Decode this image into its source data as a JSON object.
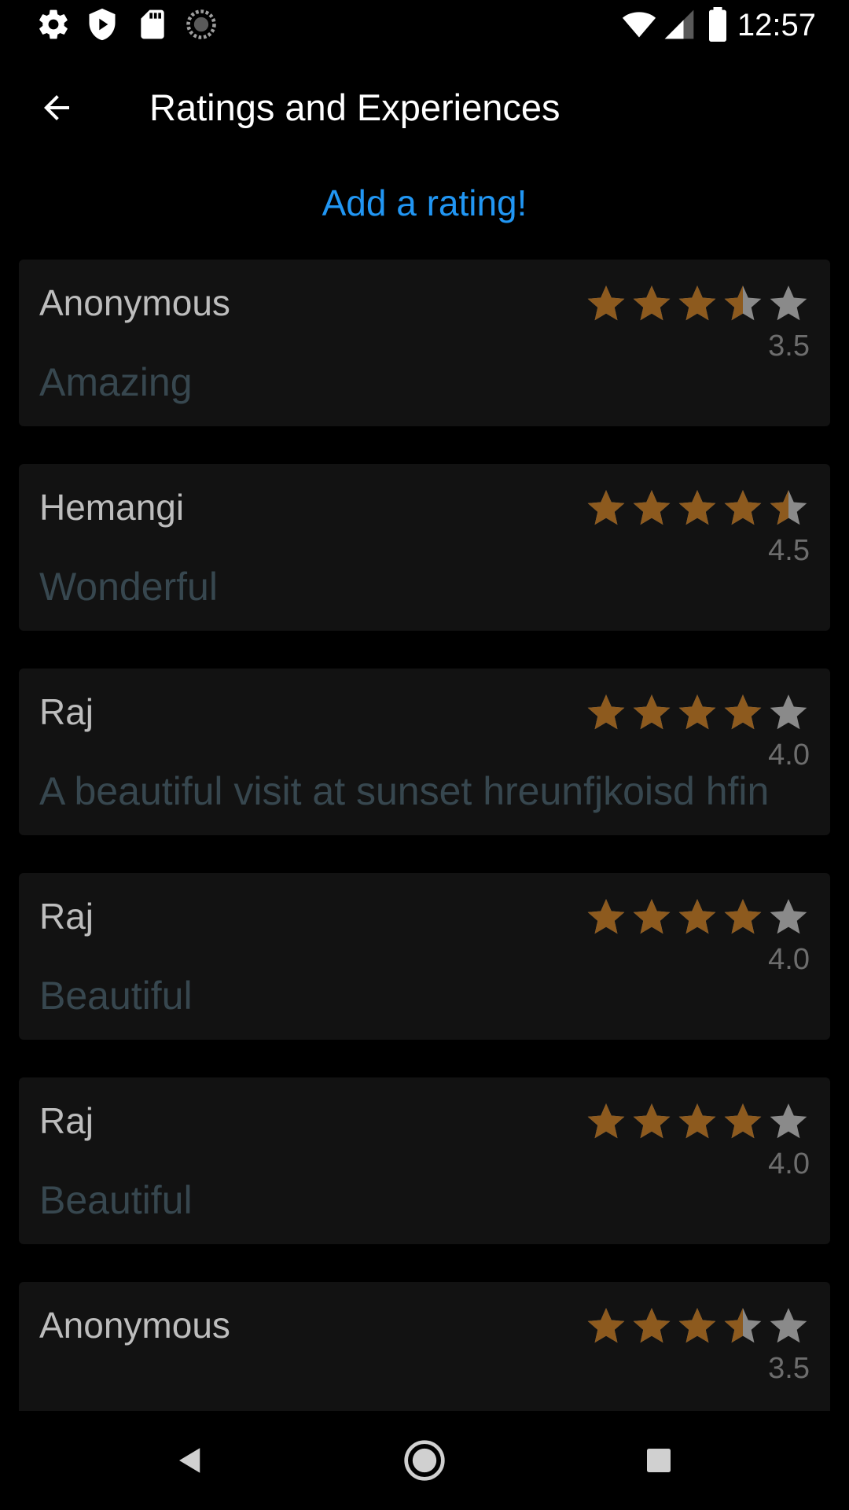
{
  "status_bar": {
    "time": "12:57",
    "left_icons": [
      "settings-icon",
      "shield-icon",
      "sd-card-icon",
      "sync-icon"
    ],
    "right_icons": [
      "wifi-icon",
      "signal-icon",
      "battery-icon"
    ]
  },
  "app_bar": {
    "title": "Ratings and Experiences",
    "back_icon": "arrow-back-icon"
  },
  "add_rating_label": "Add a rating!",
  "colors": {
    "background": "#000000",
    "card": "#121212",
    "accent": "#2196f3",
    "star_filled": "#8d5a1e",
    "star_empty": "#8a8a8a",
    "name_text": "#bdbdbd",
    "review_text": "#37474f"
  },
  "reviews": [
    {
      "name": "Anonymous",
      "rating": 3.5,
      "rating_label": "3.5",
      "text": "Amazing"
    },
    {
      "name": "Hemangi",
      "rating": 4.5,
      "rating_label": "4.5",
      "text": "Wonderful"
    },
    {
      "name": "Raj",
      "rating": 4.0,
      "rating_label": "4.0",
      "text": "A beautiful visit at sunset hreunfjkoisd hfin"
    },
    {
      "name": "Raj",
      "rating": 4.0,
      "rating_label": "4.0",
      "text": "Beautiful"
    },
    {
      "name": "Raj",
      "rating": 4.0,
      "rating_label": "4.0",
      "text": "Beautiful"
    },
    {
      "name": "Anonymous",
      "rating": 3.5,
      "rating_label": "3.5",
      "text": ""
    }
  ],
  "nav_bar": {
    "buttons": [
      "back-triangle-icon",
      "home-circle-icon",
      "recents-square-icon"
    ]
  }
}
